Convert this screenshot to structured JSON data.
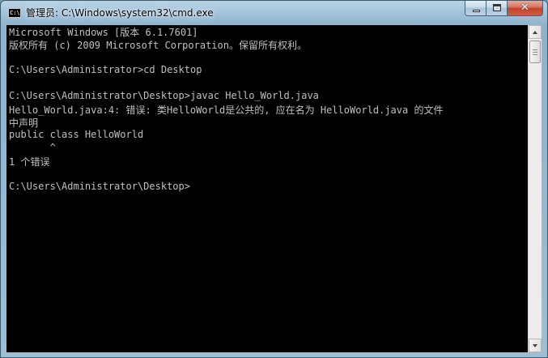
{
  "window": {
    "title": "管理员: C:\\Windows\\system32\\cmd.exe",
    "app_icon_text": "C:\\"
  },
  "caption_buttons": {
    "close_glyph": "✕"
  },
  "console": {
    "lines": [
      "Microsoft Windows [版本 6.1.7601]",
      "版权所有 (c) 2009 Microsoft Corporation。保留所有权利。",
      "",
      "C:\\Users\\Administrator>cd Desktop",
      "",
      "C:\\Users\\Administrator\\Desktop>javac Hello_World.java",
      "Hello_World.java:4: 错误: 类HelloWorld是公共的, 应在名为 HelloWorld.java 的文件",
      "中声明",
      "public class HelloWorld",
      "       ^",
      "1 个错误",
      "",
      "C:\\Users\\Administrator\\Desktop>"
    ]
  },
  "colors": {
    "console_background": "#000000",
    "console_text": "#c0c0c0",
    "close_button": "#c2432b"
  }
}
